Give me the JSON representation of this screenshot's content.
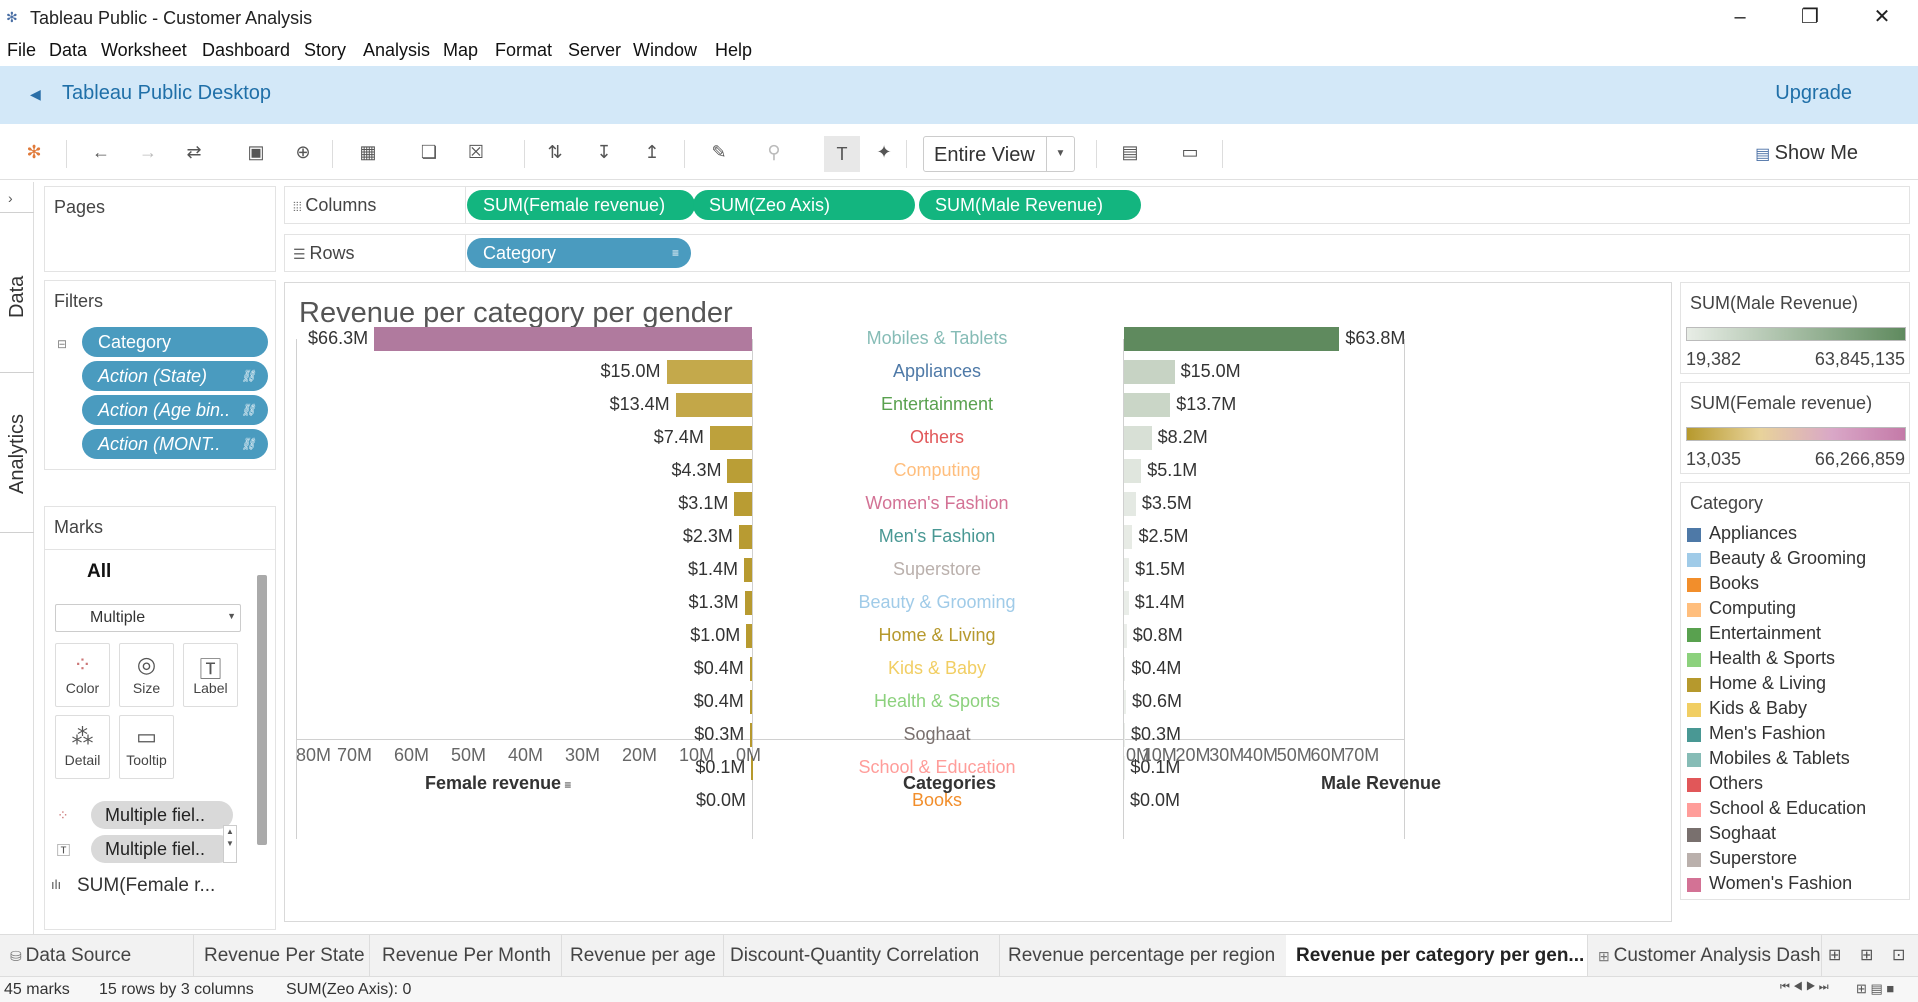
{
  "window": {
    "title": "Tableau Public - Customer Analysis",
    "controls": [
      "minimize",
      "restore",
      "close"
    ]
  },
  "menu": [
    "File",
    "Data",
    "Worksheet",
    "Dashboard",
    "Story",
    "Analysis",
    "Map",
    "Format",
    "Server",
    "Window",
    "Help"
  ],
  "banner": {
    "title": "Tableau Public Desktop",
    "upgrade": "Upgrade"
  },
  "toolbar": {
    "fit": "Entire View",
    "show_me": "Show Me"
  },
  "side_tabs": {
    "data": "Data",
    "analytics": "Analytics"
  },
  "pages": {
    "title": "Pages"
  },
  "filters": {
    "title": "Filters",
    "items": [
      "Category",
      "Action (State)",
      "Action (Age bin..",
      "Action (MONT.."
    ]
  },
  "marks": {
    "title": "Marks",
    "all": "All",
    "type": "Multiple",
    "buttons": [
      "Color",
      "Size",
      "Label",
      "Detail",
      "Tooltip"
    ],
    "pills": [
      "Multiple fiel..",
      "Multiple fiel.."
    ],
    "measure": "SUM(Female r..."
  },
  "shelves": {
    "columns_label": "Columns",
    "rows_label": "Rows",
    "columns": [
      "SUM(Female revenue)",
      "SUM(Zeo Axis)",
      "SUM(Male Revenue)"
    ],
    "rows": [
      "Category"
    ]
  },
  "colors": {
    "male_bar": "#5f8a5e",
    "female_top": "#b07a9e",
    "female_bar": "#c0a13a",
    "accent": "#13b57f",
    "pill_blue": "#4a9bbf",
    "banner": "#d3e8f8"
  },
  "viz": {
    "title": "Revenue per category per gender",
    "female_ticks": [
      "80M",
      "70M",
      "60M",
      "50M",
      "40M",
      "30M",
      "20M",
      "10M",
      "0M"
    ],
    "male_ticks": [
      "0M",
      "10M",
      "20M",
      "30M",
      "40M",
      "50M",
      "60M",
      "70M"
    ],
    "female_axis_title": "Female revenue",
    "categories_axis_title": "Categories",
    "male_axis_title": "Male Revenue"
  },
  "chart_data": {
    "type": "bar",
    "title": "Revenue per category per gender",
    "categories": [
      "Mobiles & Tablets",
      "Appliances",
      "Entertainment",
      "Others",
      "Computing",
      "Women's Fashion",
      "Men's Fashion",
      "Superstore",
      "Beauty & Grooming",
      "Home & Living",
      "Kids & Baby",
      "Health & Sports",
      "Soghaat",
      "School & Education",
      "Books"
    ],
    "category_colors": [
      "#86bcb6",
      "#4e79a7",
      "#59a14f",
      "#e15759",
      "#ffbe7d",
      "#d37295",
      "#499894",
      "#bab0ac",
      "#a0cbe8",
      "#b6992d",
      "#f1ce63",
      "#8cd17d",
      "#79706e",
      "#ff9d9a",
      "#f28e2b"
    ],
    "series": [
      {
        "name": "Female revenue",
        "values": [
          66.3,
          15.0,
          13.4,
          7.4,
          4.3,
          3.1,
          2.3,
          1.4,
          1.3,
          1.0,
          0.4,
          0.4,
          0.3,
          0.1,
          0.0
        ],
        "labels": [
          "$66.3M",
          "$15.0M",
          "$13.4M",
          "$7.4M",
          "$4.3M",
          "$3.1M",
          "$2.3M",
          "$1.4M",
          "$1.3M",
          "$1.0M",
          "$0.4M",
          "$0.4M",
          "$0.3M",
          "$0.1M",
          "$0.0M"
        ],
        "xlim": [
          0,
          80
        ]
      },
      {
        "name": "Male Revenue",
        "values": [
          63.8,
          15.0,
          13.7,
          8.2,
          5.1,
          3.5,
          2.5,
          1.5,
          1.4,
          0.8,
          0.4,
          0.6,
          0.3,
          0.1,
          0.0
        ],
        "labels": [
          "$63.8M",
          "$15.0M",
          "$13.7M",
          "$8.2M",
          "$5.1M",
          "$3.5M",
          "$2.5M",
          "$1.5M",
          "$1.4M",
          "$0.8M",
          "$0.4M",
          "$0.6M",
          "$0.3M",
          "$0.1M",
          "$0.0M"
        ],
        "xlim": [
          0,
          80
        ]
      }
    ],
    "xlabel_left": "Female revenue",
    "xlabel_center": "Categories",
    "xlabel_right": "Male Revenue"
  },
  "legends": {
    "male": {
      "title": "SUM(Male Revenue)",
      "min": "19,382",
      "max": "63,845,135",
      "colors": [
        "#e8ede6",
        "#5f8a5e"
      ]
    },
    "female": {
      "title": "SUM(Female revenue)",
      "min": "13,035",
      "max": "66,266,859",
      "colors": [
        "#b6992d",
        "#e8d39a",
        "#d9a7c7",
        "#c47aa8"
      ]
    },
    "category": {
      "title": "Category",
      "items": [
        {
          "label": "Appliances",
          "color": "#4e79a7"
        },
        {
          "label": "Beauty & Grooming",
          "color": "#a0cbe8"
        },
        {
          "label": "Books",
          "color": "#f28e2b"
        },
        {
          "label": "Computing",
          "color": "#ffbe7d"
        },
        {
          "label": "Entertainment",
          "color": "#59a14f"
        },
        {
          "label": "Health & Sports",
          "color": "#8cd17d"
        },
        {
          "label": "Home & Living",
          "color": "#b6992d"
        },
        {
          "label": "Kids & Baby",
          "color": "#f1ce63"
        },
        {
          "label": "Men's Fashion",
          "color": "#499894"
        },
        {
          "label": "Mobiles & Tablets",
          "color": "#86bcb6"
        },
        {
          "label": "Others",
          "color": "#e15759"
        },
        {
          "label": "School & Education",
          "color": "#ff9d9a"
        },
        {
          "label": "Soghaat",
          "color": "#79706e"
        },
        {
          "label": "Superstore",
          "color": "#bab0ac"
        },
        {
          "label": "Women's Fashion",
          "color": "#d37295"
        }
      ]
    }
  },
  "tabs": {
    "data_source": "Data Source",
    "sheets": [
      "Revenue Per State",
      "Revenue Per Month",
      "Revenue per age",
      "Discount-Quantity Correlation",
      "Revenue percentage per region",
      "Revenue per category per gen...",
      "Customer Analysis Dashb"
    ]
  },
  "status": {
    "marks": "45 marks",
    "dims": "15 rows by 3 columns",
    "sum": "SUM(Zeo Axis): 0"
  }
}
